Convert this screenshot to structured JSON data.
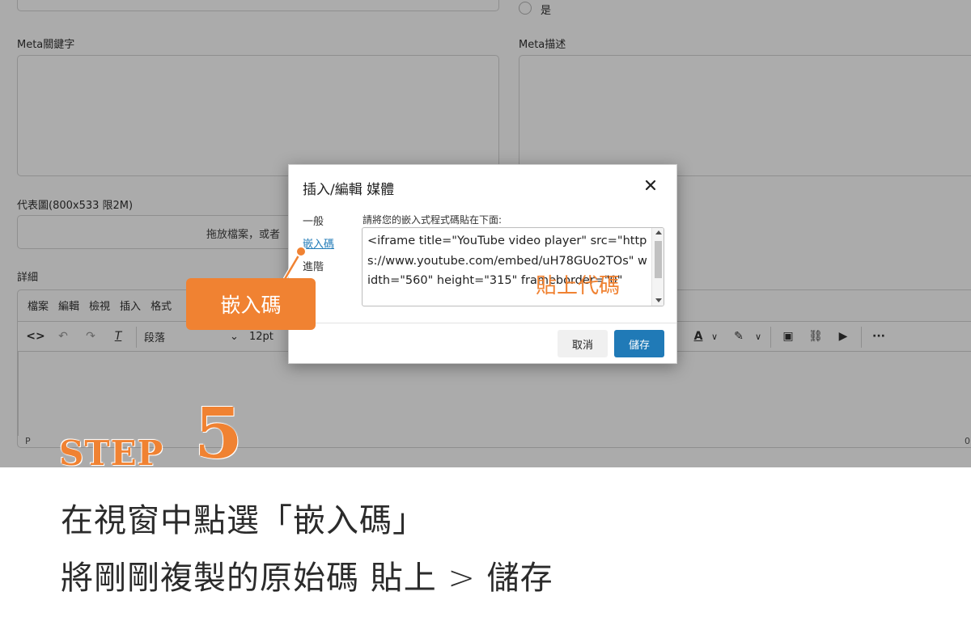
{
  "form": {
    "radio_label": "是",
    "meta_keywords_label": "Meta關鍵字",
    "meta_description_label": "Meta描述",
    "cover_image_label": "代表圖(800x533 限2M)",
    "dropzone_text": "拖放檔案，或者",
    "details_label": "詳細",
    "status_path": "P",
    "status_right": "0"
  },
  "editor": {
    "menu": [
      "檔案",
      "編輯",
      "檢視",
      "插入",
      "格式"
    ],
    "paragraph_select": "段落",
    "font_size": "12pt"
  },
  "dialog": {
    "title": "插入/編輯 媒體",
    "nav": [
      "一般",
      "嵌入碼",
      "進階"
    ],
    "active_nav": "嵌入碼",
    "hint": "請將您的嵌入式程式碼貼在下面:",
    "code": "<iframe title=\"YouTube video player\" src=\"https://www.youtube.com/embed/uH78GUo2TOs\" width=\"560\" height=\"315\" frameborder=\"0\"",
    "cancel": "取消",
    "save": "儲存",
    "accent_color": "#207ab7"
  },
  "annotation": {
    "callout": "嵌入碼",
    "paste_note": "貼上代碼",
    "accent_color": "#f08232"
  },
  "step": {
    "word": "STEP",
    "number": "5",
    "line1": "在視窗中點選「嵌入碼」",
    "line2": "將剛剛複製的原始碼 貼上 > 儲存"
  }
}
